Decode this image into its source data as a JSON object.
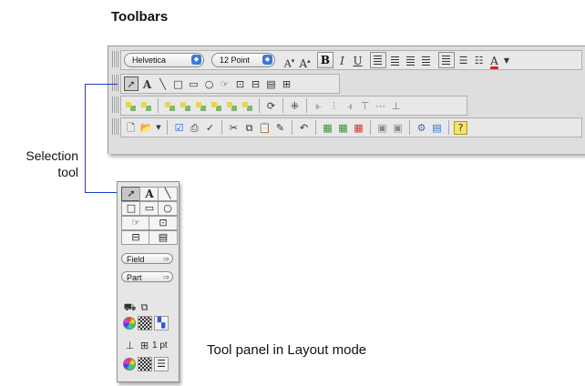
{
  "heading": "Toolbars",
  "toolbar_formatting": {
    "font_value": "Helvetica",
    "size_value": "12 Point",
    "decrease_size": "A",
    "increase_size": "A",
    "bold": "B",
    "italic": "I",
    "underline": "U",
    "text_color_label": "A"
  },
  "toolbar_tools": {
    "text_tool": "A"
  },
  "callout": {
    "line1": "Selection",
    "line2": "tool"
  },
  "tool_panel": {
    "text_tool": "A",
    "field_value": "Field",
    "part_value": "Part",
    "line_width_value": "1 pt"
  },
  "caption": "Tool panel in Layout mode",
  "colors": {
    "accent": "#3b78d4",
    "callout_line": "#1a3fd0"
  }
}
